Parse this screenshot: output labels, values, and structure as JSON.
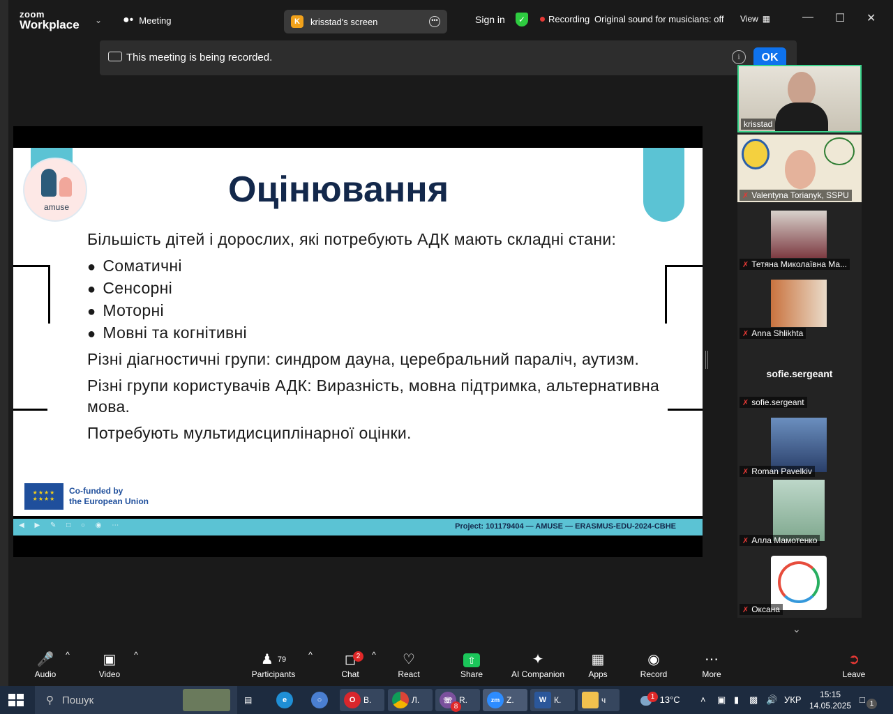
{
  "titlebar": {
    "brand_top": "zoom",
    "brand_bottom": "Workplace",
    "meeting_label": "Meeting",
    "screen_owner_initial": "K",
    "screen_label": "krisstad's screen",
    "signin": "Sign in",
    "recording": "Recording",
    "original_sound": "Original sound for musicians: off",
    "view": "View"
  },
  "banner": {
    "text": "This meeting is being recorded.",
    "ok": "OK"
  },
  "slide": {
    "logo_text": "amuse",
    "title": "Оцінювання",
    "intro": "Більшість дітей і дорослих, які потребують АДК мають складні стани:",
    "bullets": [
      "Соматичні",
      "Сенсорні",
      "Моторні",
      "Мовні та когнітивні"
    ],
    "para2": "Різні діагностичні групи: синдром дауна, церебральний параліч, аутизм.",
    "para3": "Різні групи користувачів АДК: Виразність, мовна підтримка, альтернативна мова.",
    "para4": "Потребують мультидисциплінарної оцінки.",
    "eu_line1": "Co-funded by",
    "eu_line2": "the European Union",
    "footer": "Project: 101179404 — AMUSE — ERASMUS-EDU-2024-CBHE"
  },
  "participants": [
    {
      "name": "krisstad",
      "muted": false,
      "active": true
    },
    {
      "name": "Valentyna Torianyk, SSPU",
      "muted": true
    },
    {
      "name": "Тетяна Миколаївна Ма...",
      "muted": true
    },
    {
      "name": "Anna Shlikhta",
      "muted": true
    },
    {
      "name": "sofie.sergeant",
      "muted": true,
      "no_video": true
    },
    {
      "name": "Roman Pavelkiv",
      "muted": true
    },
    {
      "name": "Алла Мамотенко",
      "muted": true
    },
    {
      "name": "Оксана",
      "muted": true
    }
  ],
  "toolbar": {
    "audio": "Audio",
    "video": "Video",
    "participants": "Participants",
    "participants_count": "79",
    "chat": "Chat",
    "chat_badge": "2",
    "react": "React",
    "share": "Share",
    "ai": "AI Companion",
    "apps": "Apps",
    "record": "Record",
    "more": "More",
    "leave": "Leave"
  },
  "taskbar": {
    "search_placeholder": "Пошук",
    "apps": [
      {
        "label": "В.",
        "icon": "opera-icon"
      },
      {
        "label": "Л.",
        "icon": "chrome-icon"
      },
      {
        "label": "R.",
        "icon": "viber-icon",
        "badge": "8"
      },
      {
        "label": "Z.",
        "icon": "zoom-icon"
      },
      {
        "label": "К.",
        "icon": "word-icon"
      },
      {
        "label": "ч",
        "icon": "folder-icon"
      }
    ],
    "weather_badge": "1",
    "temperature": "13°C",
    "language": "УКР",
    "time": "15:15",
    "date": "14.05.2025",
    "notif_count": "1"
  },
  "colors": {
    "accent_blue": "#0e72ed",
    "active_speaker": "#3ed68e",
    "slide_teal": "#5bc3d4",
    "slide_title": "#13284b",
    "recording_red": "#e53935"
  }
}
